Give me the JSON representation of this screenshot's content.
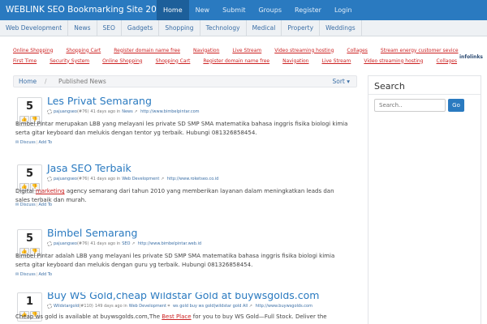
{
  "header": {
    "brand": "WEBLINK SEO Bookmarking Site 2014",
    "nav": [
      "Home",
      "New",
      "Submit",
      "Groups",
      "Register",
      "Login"
    ]
  },
  "categories": [
    "Web Development",
    "News",
    "SEO",
    "Gadgets",
    "Shopping",
    "Technology",
    "Medical",
    "Property",
    "Weddings"
  ],
  "ad_links": {
    "row1": [
      "Online Shopping",
      "Shopping Cart",
      "Register domain name free",
      "Navigation",
      "Live Stream",
      "Video streaming hosting",
      "Collages",
      "Stream energy customer sevice"
    ],
    "row2": [
      "First Time",
      "Security System",
      "Online Shopping",
      "Shopping Cart",
      "Register domain name free",
      "Navigation",
      "Live Stream",
      "Video streaming hosting",
      "Collages"
    ],
    "brand": "infolinks"
  },
  "breadcrumb": {
    "home": "Home",
    "separator": "/",
    "current": "Published News",
    "sort": "Sort"
  },
  "sidebar": {
    "heading": "Search",
    "placeholder": "Search..",
    "button": "Go"
  },
  "posts": [
    {
      "votes": "5",
      "title": "Les Privat Semarang",
      "user": "pajuangseo",
      "user_count": "(#76)",
      "age": "41 days ago in",
      "category": "News",
      "url": "http://www.bimbelpintar.com",
      "desc": "Bimbel Pintar merupakan LBB yang melayani les private SD SMP SMA matematika bahasa inggris fisika biologi kimia serta gitar keyboard dan melukis dengan tentor yg terbaik. Hubungi 081326858454.",
      "discuss": "Discuss",
      "add": "Add To"
    },
    {
      "votes": "5",
      "title": "Jasa SEO Terbaik",
      "user": "pajuangseo",
      "user_count": "(#76)",
      "age": "41 days ago in",
      "category": "Web Development",
      "url": "http://www.roketseo.co.id",
      "desc_pre": "Digital ",
      "desc_link": "marketing",
      "desc_post": " agency semarang dari tahun 2010 yang memberikan layanan dalam meningkatkan leads dan sales terbaik dan murah.",
      "discuss": "Discuss",
      "add": "Add To"
    },
    {
      "votes": "5",
      "title": "Bimbel Semarang",
      "user": "pajuangseo",
      "user_count": "(#76)",
      "age": "41 days ago in",
      "category": "SEO",
      "url": "http://www.bimbelpintar.web.id",
      "desc": "Bimbel Pintar adalah LBB yang melayani les private SD SMP SMA matematika bahasa inggris fisika biologi kimia serta gitar keyboard dan melukis dengan guru yg terbaik. Hubungi 081326858454.",
      "discuss": "Discuss",
      "add": "Add To"
    },
    {
      "votes": "1",
      "title": "Buy WS Gold,cheap Wildstar Gold at buywsgolds.com",
      "user": "Wildstargold",
      "user_count": "(#110)",
      "age": "149 days ago in",
      "category": "Web Development",
      "tags": "ws gold buy ws gold|wildstar gold All",
      "url": "http://www.buywsgolds.com",
      "desc_pre": "Cheap ws gold is available at buywsgolds.com,The ",
      "desc_link": "Best Place",
      "desc_post": " for you to buy WS Gold—Full Stock. Deliver the"
    }
  ]
}
